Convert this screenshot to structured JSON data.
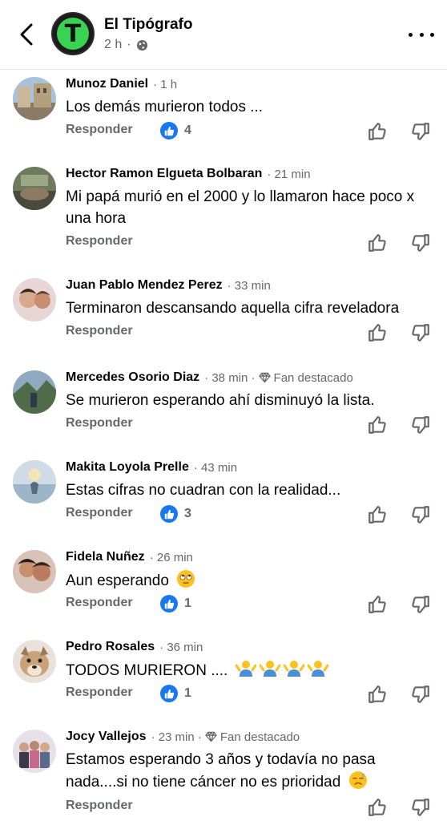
{
  "header": {
    "page_name": "El Tipógrafo",
    "time": "2 h",
    "logo_letter": "T"
  },
  "reply_label": "Responder",
  "comments": [
    {
      "name": "Munoz Daniel",
      "time": "1 h",
      "fan": "",
      "text": "Los demás murieron todos ...",
      "reactions": "4"
    },
    {
      "name": "Hector Ramon Elgueta Bolbaran",
      "time": "21 min",
      "fan": "",
      "text": "Mi papá murió en el 2000 y lo llamaron hace poco x una hora",
      "reactions": ""
    },
    {
      "name": "Juan Pablo Mendez Perez",
      "time": "33 min",
      "fan": "",
      "text": "Terminaron  descansando aquella cifra reveladora",
      "reactions": ""
    },
    {
      "name": "Mercedes Osorio Diaz",
      "time": "38 min",
      "fan": "Fan destacado",
      "text": "Se murieron esperando ahí disminuyó la lista.",
      "reactions": ""
    },
    {
      "name": "Makita Loyola Prelle",
      "time": "43 min",
      "fan": "",
      "text": "Estas cifras no cuadran con la realidad...",
      "reactions": "3"
    },
    {
      "name": "Fidela Nuñez",
      "time": "26 min",
      "fan": "",
      "text": "Aun esperando",
      "emoji": "eye-roll",
      "reactions": "1"
    },
    {
      "name": "Pedro Rosales",
      "time": "36 min",
      "fan": "",
      "text": "TODOS MURIERON ....",
      "emoji": "shrug-x4",
      "reactions": "1"
    },
    {
      "name": "Jocy Vallejos",
      "time": "23 min",
      "fan": "Fan destacado",
      "text": "Estamos esperando 3 años y todavía no pasa nada....si no tiene cáncer no es prioridad",
      "emoji": "sad-sweat",
      "reactions": ""
    }
  ],
  "colors": {
    "like_blue": "#1877f2",
    "secondary_text": "#65676b",
    "logo_green": "#39d353"
  }
}
